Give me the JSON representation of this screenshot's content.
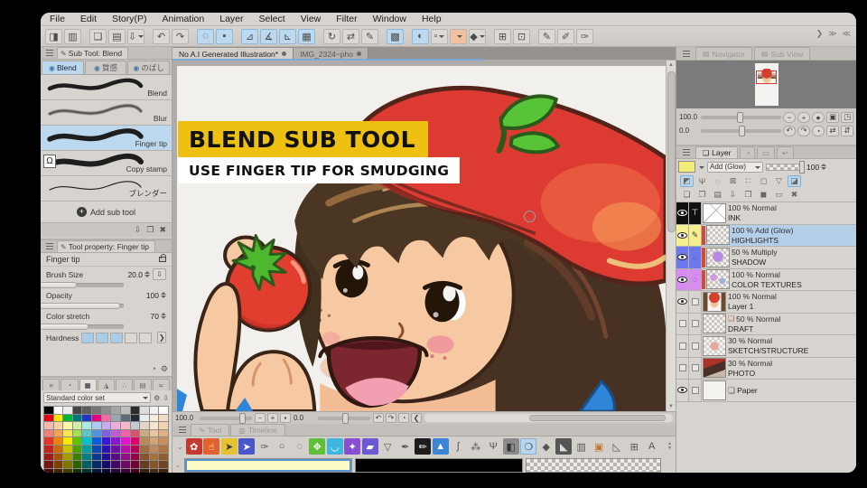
{
  "menu": {
    "items": [
      "File",
      "Edit",
      "Story(P)",
      "Animation",
      "Layer",
      "Select",
      "View",
      "Filter",
      "Window",
      "Help"
    ]
  },
  "toolbar": {
    "items": [
      {
        "n": "workspace-icon",
        "g": "◨"
      },
      {
        "n": "tablet-mode-icon",
        "g": "▥"
      },
      {
        "s": 1
      },
      {
        "n": "new-file-icon",
        "g": "❏"
      },
      {
        "n": "open-file-icon",
        "g": "▤"
      },
      {
        "n": "save-export-icon",
        "g": "⇩",
        "dd": 1
      },
      {
        "s": 1
      },
      {
        "n": "undo-icon",
        "g": "↶"
      },
      {
        "n": "redo-icon",
        "g": "↷"
      },
      {
        "s": 1
      },
      {
        "n": "processing-icon",
        "g": "◌",
        "cls": "d"
      },
      {
        "n": "stop-icon",
        "g": "▪",
        "cls": "d"
      },
      {
        "s": 1
      },
      {
        "n": "snap-ruler-icon",
        "g": "⊿",
        "cls": "a"
      },
      {
        "n": "snap-perspective-icon",
        "g": "∡",
        "cls": "a"
      },
      {
        "n": "snap-special-icon",
        "g": "⊾",
        "cls": "a"
      },
      {
        "n": "grid-icon",
        "g": "▦",
        "cls": "c"
      },
      {
        "s": 1
      },
      {
        "n": "rotate-canvas-icon",
        "g": "↻"
      },
      {
        "n": "flip-canvas-icon",
        "g": "⇄"
      },
      {
        "n": "vector-snap-icon",
        "g": "✎"
      },
      {
        "s": 1
      },
      {
        "n": "select-area-icon",
        "g": "▩",
        "cls": "d"
      },
      {
        "s": 1
      },
      {
        "n": "antialias-icon",
        "g": "◐",
        "cls": "k"
      },
      {
        "n": "brush-shape-icon",
        "g": "▫",
        "dd": 1
      },
      {
        "n": "paper-color-swatch",
        "g": " ",
        "bg": "#f2c2a0",
        "dd": 1
      },
      {
        "n": "figure-burst-icon",
        "g": "◆",
        "dd": 1
      },
      {
        "s": 1
      },
      {
        "n": "mesh-transform-icon",
        "g": "⊞"
      },
      {
        "n": "mesh-edit-icon",
        "g": "⊡"
      },
      {
        "s": 1
      },
      {
        "n": "stroke-pen-icon",
        "g": "✎"
      },
      {
        "n": "stroke-pencil-icon",
        "g": "✐"
      },
      {
        "n": "stroke-brush-icon",
        "g": "✑"
      }
    ],
    "corner_icons": [
      {
        "n": "overflow-icon",
        "g": "❯"
      },
      {
        "n": "collapse-dock-icon",
        "g": "≫"
      },
      {
        "n": "expand-dock-icon",
        "g": "≪"
      }
    ]
  },
  "document_tabs": [
    {
      "label": "No A.I Generated Illustration*",
      "active": true
    },
    {
      "label": "IMG_2324~pho",
      "active": false
    }
  ],
  "overlay": {
    "title": "BLEND SUB TOOL",
    "subtitle": "USE FINGER TIP FOR SMUDGING",
    "title_bg": "#edc012",
    "subtitle_bg": "#ffffff"
  },
  "subtool_panel": {
    "title": "Sub Tool: Blend",
    "tabs": [
      {
        "label": "Blend",
        "active": true
      },
      {
        "label": "質感",
        "active": false
      },
      {
        "label": "のばし",
        "active": false
      }
    ],
    "brushes": [
      {
        "name": "Blend",
        "stroke": "thick"
      },
      {
        "name": "Blur",
        "stroke": "blur"
      },
      {
        "name": "Finger tip",
        "stroke": "finger",
        "selected": true
      },
      {
        "name": "Copy stamp",
        "stroke": "stamp",
        "stamp": true,
        "stamp_glyph": "Ω"
      },
      {
        "name": "ブレンダー",
        "stroke": "thin"
      }
    ],
    "add_label": "Add sub tool",
    "footer_icons": [
      {
        "n": "import-subtool-icon",
        "g": "⇩"
      },
      {
        "n": "duplicate-subtool-icon",
        "g": "❐"
      },
      {
        "n": "delete-subtool-icon",
        "g": "✖"
      }
    ]
  },
  "tool_property": {
    "title": "Tool property: Finger tip",
    "tool_name": "Finger tip",
    "rows": [
      {
        "label": "Brush Size",
        "value": "20.0",
        "fill": "42%",
        "btn": "⇩"
      },
      {
        "label": "Opacity",
        "value": "100",
        "fill": "95%"
      },
      {
        "label": "Color stretch",
        "value": "70",
        "fill": "56%"
      }
    ],
    "hardness_label": "Hardness",
    "hardness": [
      1,
      1,
      1,
      0,
      0
    ],
    "expand_glyph": "❯",
    "footer_icons": [
      {
        "n": "register-preset-icon",
        "g": "◔"
      },
      {
        "n": "settings-wrench-icon",
        "g": "⚙"
      }
    ]
  },
  "color_set": {
    "tabs": [
      {
        "n": "panel-menu-icon",
        "g": "≡"
      },
      {
        "n": "color-wheel-tab",
        "g": "◔"
      },
      {
        "n": "color-set-tab",
        "g": "▦",
        "active": true
      },
      {
        "n": "mixing-tab",
        "g": "◮"
      },
      {
        "n": "intermediate-tab",
        "g": "∴"
      },
      {
        "n": "history-tab",
        "g": "▤"
      },
      {
        "n": "more-tab",
        "g": "≍"
      }
    ],
    "dropdown": "Standard color set",
    "tool_icons": [
      {
        "n": "edit-colorset-icon",
        "g": "⚙"
      },
      {
        "n": "import-colorset-icon",
        "g": "⇩"
      }
    ],
    "palette": [
      "#000000",
      "#ffffff",
      "#ececec",
      "#454545",
      "#5d5d5d",
      "#757575",
      "#8d8d8d",
      "#a5a5a5",
      "#bdbdbd",
      "#2b2b2b",
      "#dedede",
      "#f1f1f1",
      "#fafafa",
      "#e60012",
      "#ffe600",
      "#00b437",
      "#00787a",
      "#2233c8",
      "#e4007f",
      "#ef6ea8",
      "#9aa6b4",
      "#5f6b78",
      "#222c38",
      "#e9eef3",
      "#f6ecdc",
      "#f1ddc3",
      "#f7b6b0",
      "#fbd3a4",
      "#fdf6a6",
      "#cdf0a4",
      "#aaeae4",
      "#abcbf4",
      "#c6adf2",
      "#ecacdf",
      "#f4b7cb",
      "#c2cad2",
      "#e2d5c5",
      "#f6e4ce",
      "#f0d3b3",
      "#ef8176",
      "#f5a452",
      "#f9e456",
      "#a5df52",
      "#55cbc3",
      "#4f92e2",
      "#7e60e2",
      "#c258da",
      "#f164aa",
      "#d9536e",
      "#cbab82",
      "#eac49c",
      "#dfae82",
      "#e8332a",
      "#f28300",
      "#f7e800",
      "#5fc200",
      "#00c2ca",
      "#0a5cd8",
      "#3715dd",
      "#8815d2",
      "#dc17cc",
      "#e2006e",
      "#b98a5a",
      "#d6a273",
      "#c98e5e",
      "#c22420",
      "#ca6a02",
      "#cbbf02",
      "#4c9e02",
      "#029ea4",
      "#0c4ab0",
      "#2c10b4",
      "#6d10aa",
      "#b412a6",
      "#b80257",
      "#a06c42",
      "#bd8a5c",
      "#ad7546",
      "#9c1d1a",
      "#a35502",
      "#a49a02",
      "#3d7f02",
      "#027f84",
      "#0a3b8d",
      "#240d91",
      "#580d88",
      "#910f86",
      "#940246",
      "#86532f",
      "#a4713f",
      "#8f5c33",
      "#761614",
      "#7c4102",
      "#7d7502",
      "#2e6001",
      "#016064",
      "#082c6a",
      "#1b0a6e",
      "#420a67",
      "#6e0b65",
      "#700135",
      "#643c20",
      "#845626",
      "#6f4523",
      "#3f0c0a",
      "#422301",
      "#423e01",
      "#183301",
      "#013335",
      "#041839",
      "#0e0539",
      "#230537",
      "#3a0536",
      "#3b011c",
      "#351f10",
      "#462e14",
      "#3a2412"
    ],
    "marks": [
      "#c23b2a",
      "#3aa53a",
      "#2a3bc2"
    ],
    "footer_icons": [
      {
        "n": "copy-swatch-icon",
        "g": "❏"
      },
      {
        "n": "add-color-icon",
        "g": "✚"
      },
      {
        "n": "delete-color-icon",
        "g": "✖"
      }
    ]
  },
  "navigator": {
    "tabs": [
      {
        "label": "Navigator",
        "active": true
      },
      {
        "label": "Sub View",
        "active": false
      }
    ],
    "zoom": "100.0",
    "rotation": "0.0",
    "zoom_buttons": [
      {
        "n": "zoom-out-button",
        "g": "−"
      },
      {
        "n": "zoom-in-button",
        "g": "+"
      },
      {
        "n": "zoom-100-button",
        "g": "●"
      },
      {
        "n": "fit-screen-button",
        "g": "▣",
        "sq": 1
      },
      {
        "n": "fit-window-button",
        "g": "◳",
        "sq": 1
      }
    ],
    "rotate_buttons": [
      {
        "n": "rotate-left-button",
        "g": "↶"
      },
      {
        "n": "rotate-right-button",
        "g": "↷"
      },
      {
        "n": "reset-rotation-button",
        "g": "◔"
      },
      {
        "n": "flip-horizontal-button",
        "g": "⇄",
        "sq": 1
      },
      {
        "n": "reset-view-button",
        "g": "⇵",
        "sq": 1
      }
    ]
  },
  "layer_panel": {
    "tab": "Layer",
    "icon_tabs": [
      {
        "n": "layer-property-tab",
        "g": "◔"
      },
      {
        "n": "animation-cels-tab",
        "g": "▭"
      },
      {
        "n": "layer-search-tab",
        "g": "↩"
      }
    ],
    "swatch_color": "#f3ee7a",
    "blend_mode": "Add (Glow)",
    "opacity": "100",
    "icons1": [
      {
        "n": "clip-at-layer-icon",
        "g": "◩",
        "cls": "on"
      },
      {
        "n": "reference-layer-icon",
        "g": "Ψ"
      },
      {
        "n": "onion-skin-icon",
        "g": "◌"
      },
      {
        "n": "lock-layer-icon",
        "g": "⊠"
      },
      {
        "n": "lock-transparent-icon",
        "g": "∷"
      },
      {
        "n": "enable-mask-icon",
        "g": "◻"
      },
      {
        "n": "ruler-layer-icon",
        "g": "▽"
      },
      {
        "n": "layer-color-icon",
        "g": "◪",
        "cls": "blue"
      }
    ],
    "icons2": [
      {
        "n": "new-raster-layer-icon",
        "g": "❏"
      },
      {
        "n": "new-layer-dialog-icon",
        "g": "❐"
      },
      {
        "n": "new-folder-icon",
        "g": "▤"
      },
      {
        "n": "transfer-layer-icon",
        "g": "⇩"
      },
      {
        "n": "merge-layer-icon",
        "g": "❐"
      },
      {
        "n": "fill-layer-icon",
        "g": "◼"
      },
      {
        "n": "frame-layer-icon",
        "g": "▭"
      },
      {
        "n": "delete-layer-icon",
        "g": "✖"
      }
    ],
    "layers": [
      {
        "mode": "100 % Normal",
        "name": "INK",
        "label": "#101010",
        "inv": true,
        "eye": true,
        "tool_icon": "⊤",
        "tfg": "#ffffff",
        "thumb": "ink"
      },
      {
        "mode": "100 % Add (Glow)",
        "name": "HIGHLIGHTS",
        "label": "#f6ef8e",
        "eye": true,
        "tool_icon": "✎",
        "tfg": "#333333",
        "thumb": "checker",
        "clip": true,
        "selected": true
      },
      {
        "mode": "50 % Multiply",
        "name": "SHADOW",
        "label": "#6f79ee",
        "eye": true,
        "tool_icon": "◌",
        "tfg": "#223",
        "thumb": "shadow",
        "clip": true
      },
      {
        "mode": "100 % Normal",
        "name": "COLOR TEXTURES",
        "label": "#d88bf0",
        "eye": true,
        "tool_icon": "◌",
        "tfg": "#325",
        "thumb": "texture",
        "clip": true
      },
      {
        "mode": "100 % Normal",
        "name": "Layer 1",
        "eye": true,
        "boxb": true,
        "thumb": "girl"
      },
      {
        "mode": "50 % Normal",
        "name": "DRAFT",
        "box2": true,
        "boxb": true,
        "draft": true,
        "draft_icon": "❏",
        "thumb": "draft"
      },
      {
        "mode": "30 % Normal",
        "name": "SKETCH/STRUCTURE",
        "box2": true,
        "boxb": true,
        "thumb": "sketch"
      },
      {
        "mode": "30 % Normal",
        "name": "PHOTO",
        "box2": true,
        "boxb": true,
        "thumb": "photo"
      },
      {
        "mode": "",
        "name": "Paper",
        "eye": true,
        "boxb": true,
        "paper": true,
        "paper_icon": "❏",
        "thumb": "paper"
      }
    ]
  },
  "canvas_bar": {
    "zoom": "100.0",
    "rotation": "0.0",
    "zoom_btns": [
      {
        "n": "zoom-out-button",
        "g": "−"
      },
      {
        "n": "zoom-in-button",
        "g": "+"
      },
      {
        "n": "zoom-fit-button",
        "g": "▪"
      }
    ],
    "rot_btns": [
      {
        "n": "rotate-left-button",
        "g": "↶"
      },
      {
        "n": "rotate-right-button",
        "g": "↷"
      },
      {
        "n": "reset-rotation-button",
        "g": "◔"
      },
      {
        "n": "scroll-left-button",
        "g": "❮"
      }
    ]
  },
  "bottom_tabs": [
    {
      "label": "Tool",
      "icon": "✎",
      "active": true
    },
    {
      "label": "Timeline",
      "icon": "▥",
      "active": false
    }
  ],
  "tool_palette": [
    {
      "n": "figure-tool",
      "g": "✿",
      "bg": "#c43a2e",
      "fg": "#ffffff"
    },
    {
      "n": "hand-tool",
      "g": "☝",
      "bg": "#e2622e",
      "fg": "#ffffff"
    },
    {
      "n": "operation-tool",
      "g": "➤",
      "bg": "#e5c231",
      "fg": "#3a3a3a"
    },
    {
      "n": "object-tool",
      "g": "➤",
      "bg": "#4a57c8",
      "fg": "#ffffff"
    },
    {
      "n": "eyedropper-tool",
      "g": "✑"
    },
    {
      "n": "ellipse-select-tool",
      "g": "○"
    },
    {
      "n": "marquee-select-tool",
      "g": "◌"
    },
    {
      "n": "move-tool",
      "g": "✥",
      "bg": "#5fbe3a",
      "fg": "#ffffff"
    },
    {
      "n": "lasso-tool",
      "g": "◡",
      "bg": "#3fb6e0",
      "fg": "#ffffff"
    },
    {
      "n": "wand-tool",
      "g": "✦",
      "bg": "#8a4ed2",
      "fg": "#ffffff"
    },
    {
      "n": "selection-pen-tool",
      "g": "▰",
      "bg": "#6b5ad2",
      "fg": "#ffffff"
    },
    {
      "n": "polyline-tool",
      "g": "▽"
    },
    {
      "n": "pen-tool",
      "g": "✒"
    },
    {
      "n": "marker-tool",
      "g": "✏",
      "bg": "#1c1c1c",
      "fg": "#ffffff"
    },
    {
      "n": "watercolor-tool",
      "g": "▲",
      "bg": "#3d85d6",
      "fg": "#ffffff"
    },
    {
      "n": "brush-tool",
      "g": "∫"
    },
    {
      "n": "airbrush-tool",
      "g": "⁂"
    },
    {
      "n": "decoration-tool",
      "g": "Ψ"
    },
    {
      "n": "shade-tool",
      "g": "◧",
      "bg": "#8b8b8b",
      "fg": "#333333"
    },
    {
      "n": "blend-tool",
      "g": "❍",
      "sel": true,
      "fg": "#334466"
    },
    {
      "n": "eraser-tool",
      "g": "◆"
    },
    {
      "n": "fill-tool",
      "g": "◣",
      "bg": "#555555",
      "fg": "#dddddd"
    },
    {
      "n": "gradient-tool",
      "g": "▥"
    },
    {
      "n": "frame-border-tool",
      "g": "▣",
      "fg": "#c07a35"
    },
    {
      "n": "ruler-tool",
      "g": "◺"
    },
    {
      "n": "grid-tool",
      "g": "⊞"
    },
    {
      "n": "text-tool",
      "g": "A"
    }
  ],
  "color_swatches": {
    "main": "#fbf9c4",
    "sub": "#000000"
  }
}
